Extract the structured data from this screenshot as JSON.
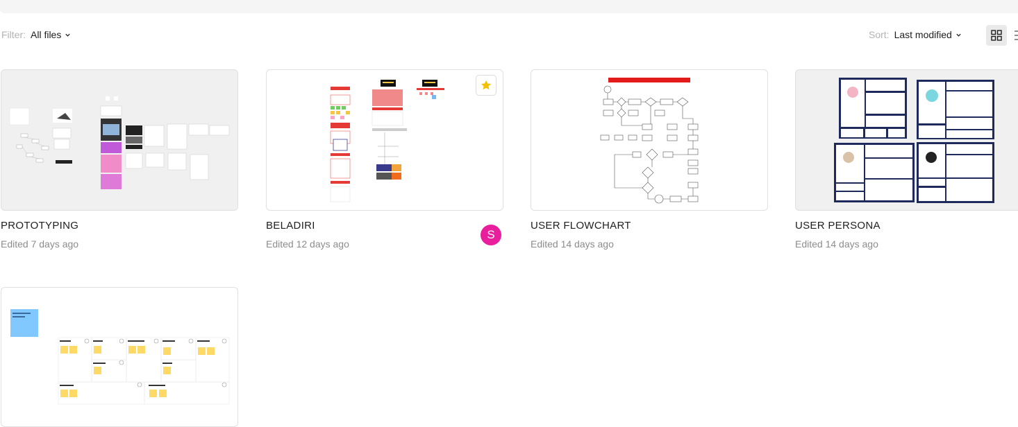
{
  "filter": {
    "label": "Filter:",
    "value": "All files"
  },
  "sort": {
    "label": "Sort:",
    "value": "Last modified"
  },
  "view": {
    "grid_icon": "grid-view-icon",
    "list_icon": "list-view-icon"
  },
  "files": [
    {
      "title": "PROTOTYPING",
      "edited": "Edited 7 days ago"
    },
    {
      "title": "BELADIRI",
      "edited": "Edited 12 days ago",
      "starred": true,
      "avatar": "S",
      "avatar_color": "#e91e9c"
    },
    {
      "title": "USER FLOWCHART",
      "edited": "Edited 14 days ago"
    },
    {
      "title": "USER PERSONA",
      "edited": "Edited 14 days ago"
    },
    {
      "title": "",
      "edited": ""
    }
  ],
  "colors": {
    "accent_star": "#f5c000",
    "persona_navy": "#1f2a5c",
    "sticky_yellow": "#ffd966",
    "sticky_blue": "#80c8ff"
  }
}
